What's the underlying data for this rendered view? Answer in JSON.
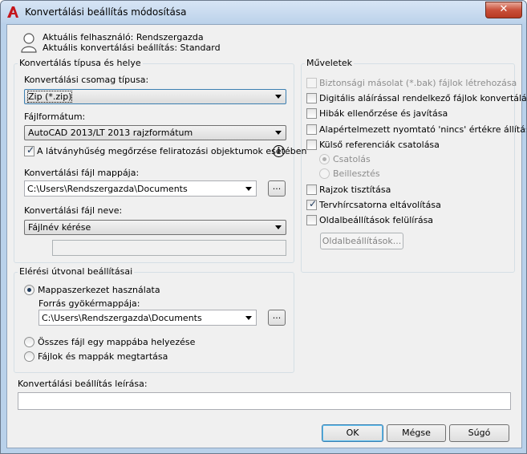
{
  "window": {
    "title": "Konvertálási beállítás módosítása",
    "close_glyph": "✕"
  },
  "user_info": {
    "current_user": "Aktuális felhasználó: Rendszergazda",
    "current_setting": "Aktuális konvertálási beállítás: Standard"
  },
  "conversion_group": {
    "title": "Konvertálás típusa és helye",
    "package_type_label": "Konvertálási csomag típusa:",
    "package_type_value": "Zip (*.zip)",
    "file_format_label": "Fájlformátum:",
    "file_format_value": "AutoCAD 2013/LT 2013 rajzformátum",
    "maintain_visual_fidelity": {
      "label": "A látványhűség megőrzése feliratozási objektumok esetében",
      "checked": true
    },
    "info_glyph": "i",
    "folder_label": "Konvertálási fájl mappája:",
    "folder_value": "C:\\Users\\Rendszergazda\\Documents",
    "browse_label": "...",
    "file_name_label": "Konvertálási fájl neve:",
    "file_name_value": "Fájlnév kérése",
    "file_name_input": ""
  },
  "path_group": {
    "title": "Elérési útvonal beállításai",
    "options": [
      {
        "label": "Mappaszerkezet használata",
        "selected": true
      },
      {
        "label": "Összes fájl egy mappába helyezése",
        "selected": false
      },
      {
        "label": "Fájlok és mappák megtartása",
        "selected": false
      }
    ],
    "source_root_label": "Forrás gyökérmappája:",
    "source_root_value": "C:\\Users\\Rendszergazda\\Documents",
    "browse_label": "..."
  },
  "actions_group": {
    "title": "Műveletek",
    "options": [
      {
        "label": "Biztonsági másolat (*.bak) fájlok létrehozása",
        "checked": false,
        "enabled": false
      },
      {
        "label": "Digitális aláírással rendelkező fájlok konvertálása",
        "checked": false,
        "enabled": true
      },
      {
        "label": "Hibák ellenőrzése és javítása",
        "checked": false,
        "enabled": true
      },
      {
        "label": "Alapértelmezett nyomtató 'nincs' értékre állítása",
        "checked": false,
        "enabled": true
      },
      {
        "label": "Külső referenciák csatolása",
        "checked": false,
        "enabled": true
      },
      {
        "label": "Rajzok tisztítása",
        "checked": false,
        "enabled": true
      },
      {
        "label": "Tervhírcsatorna eltávolítása",
        "checked": true,
        "enabled": true
      },
      {
        "label": "Oldalbeállítások felülírása",
        "checked": false,
        "enabled": true
      }
    ],
    "xref_options": [
      {
        "label": "Csatolás",
        "selected": true
      },
      {
        "label": "Beillesztés",
        "selected": false
      }
    ],
    "page_setups_button": "Oldalbeállítások..."
  },
  "description": {
    "label": "Konvertálási beállítás leírása:",
    "value": ""
  },
  "buttons": {
    "ok": "OK",
    "cancel": "Mégse",
    "help": "Súgó"
  },
  "icons": {
    "app": "autocad-logo-icon",
    "user": "user-silhouette-icon",
    "info": "info-icon",
    "dropdown": "chevron-down-icon"
  },
  "colors": {
    "title_bar": "#bcd2ea",
    "dialog_bg": "#f0f0f0",
    "close_button": "#c9503a",
    "app_logo": "#c4161c"
  }
}
